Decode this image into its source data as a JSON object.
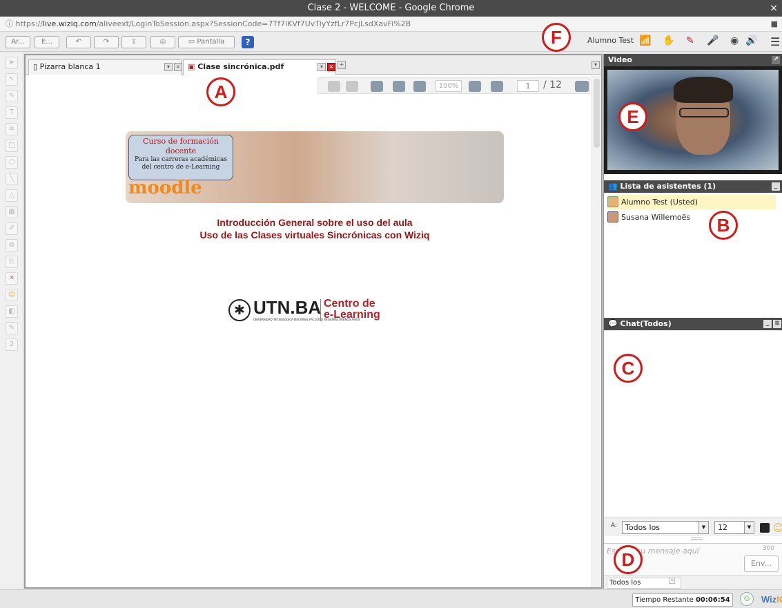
{
  "window": {
    "title": "Clase 2 - WELCOME - Google Chrome",
    "close_glyph": "×"
  },
  "address": {
    "prefix": "https://",
    "host": "live.wiziq.com",
    "path": "/aliveext/LoginToSession.aspx?SessionCode=7Tf7lKVf7UvTiyYzfLr7PcjLsdXavFi%2B"
  },
  "toolbar": {
    "btn_ar": "Ar...",
    "btn_e": "E...",
    "pantalla": "Pantalla",
    "help": "?"
  },
  "user": {
    "name": "Alumno Test"
  },
  "markers": {
    "a": "A",
    "b": "B",
    "c": "C",
    "d": "D",
    "e": "E",
    "f": "F"
  },
  "tabs": [
    {
      "label": "Pizarra blanca 1"
    },
    {
      "label": "Clase sincrónica.pdf"
    }
  ],
  "pdf_toolbar": {
    "zoom": "100%",
    "page": "1",
    "total": "/ 12"
  },
  "slide": {
    "banner_line1": "Curso de formación",
    "banner_line2": "docente",
    "banner_line3": "Para las carreras académicas",
    "banner_line4": "del centro de e-Learning",
    "moodle": "moodle",
    "heading1": "Introducción General sobre el uso del aula",
    "heading2": "Uso de las Clases virtuales Sincrónicas con Wiziq",
    "utn_logo": "UTN.BA",
    "utn_sub": "UNIVERSIDAD TECNOLÓGICA NACIONAL FACULTAD REGIONAL BUENOS AIRES",
    "cdel_1": "Centro de",
    "cdel_2": "e-Learning"
  },
  "video": {
    "title": "Video"
  },
  "attendees": {
    "title": "Lista de asistentes (1)",
    "items": [
      {
        "name": "Alumno Test (Usted)"
      },
      {
        "name": "Susana Willemoës"
      }
    ]
  },
  "chat": {
    "title": "Chat(Todos)",
    "to_label": "A:",
    "to_value": "Todos los",
    "font_size": "12",
    "placeholder": "Escriba su mensaje aquí",
    "char_limit": "300",
    "send": "Env...",
    "tab": "Todos los"
  },
  "status": {
    "remaining_label": "Tiempo Restante",
    "remaining_value": "00:06:54",
    "brand": "Wiz",
    "brand_tail": "IQ"
  },
  "colors": {
    "marker": "#d21a1a",
    "slide_heading": "#9b1414",
    "panel_header": "#4a4a4a"
  }
}
